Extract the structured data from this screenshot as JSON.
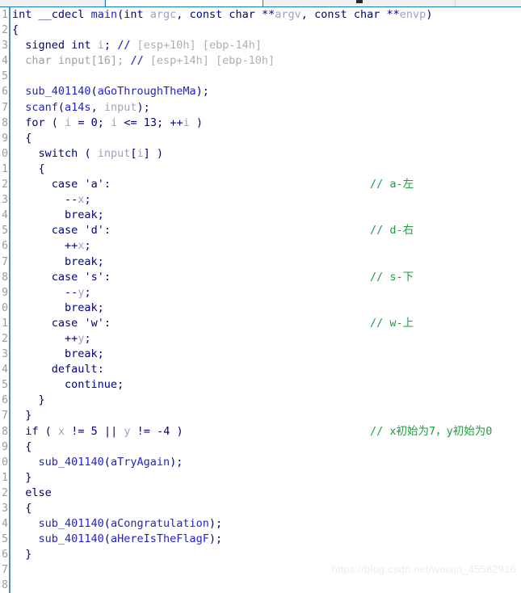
{
  "window": {
    "app": "IDA Pro - Hex-Rays Decompiler (Pseudocode view)",
    "tabs": [
      {
        "label": "",
        "active": false
      },
      {
        "label": "",
        "active": true
      },
      {
        "label": "",
        "active": false
      },
      {
        "label": "",
        "active": false
      }
    ]
  },
  "gutter": {
    "line_numbers": [
      "1",
      "2",
      "3",
      "4",
      "5",
      "6",
      "7",
      "8",
      "9",
      "0",
      "1",
      "2",
      "3",
      "4",
      "5",
      "6",
      "7",
      "8",
      "9",
      "0",
      "1",
      "2",
      "3",
      "4",
      "5",
      "6",
      "7",
      "8",
      "9",
      "0",
      "1",
      "2",
      "3",
      "4",
      "5",
      "6",
      "7",
      "8"
    ]
  },
  "code": {
    "language": "c",
    "lines": [
      {
        "n": 1,
        "text": "int __cdecl main(int argc, const char **argv, const char **envp)"
      },
      {
        "n": 2,
        "text": "{"
      },
      {
        "n": 3,
        "text": "  signed int i; // [esp+10h] [ebp-14h]"
      },
      {
        "n": 4,
        "text": "  char input[16]; // [esp+14h] [ebp-10h]"
      },
      {
        "n": 5,
        "text": ""
      },
      {
        "n": 6,
        "text": "  sub_401140(aGoThroughTheMa);"
      },
      {
        "n": 7,
        "text": "  scanf(a14s, input);"
      },
      {
        "n": 8,
        "text": "  for ( i = 0; i <= 13; ++i )"
      },
      {
        "n": 9,
        "text": "  {"
      },
      {
        "n": 10,
        "text": "    switch ( input[i] )"
      },
      {
        "n": 11,
        "text": "    {"
      },
      {
        "n": 12,
        "text": "      case 'a':",
        "comment": "// a-左"
      },
      {
        "n": 13,
        "text": "        --x;"
      },
      {
        "n": 14,
        "text": "        break;"
      },
      {
        "n": 15,
        "text": "      case 'd':",
        "comment": "// d-右"
      },
      {
        "n": 16,
        "text": "        ++x;"
      },
      {
        "n": 17,
        "text": "        break;"
      },
      {
        "n": 18,
        "text": "      case 's':",
        "comment": "// s-下"
      },
      {
        "n": 19,
        "text": "        --y;"
      },
      {
        "n": 20,
        "text": "        break;"
      },
      {
        "n": 21,
        "text": "      case 'w':",
        "comment": "// w-上"
      },
      {
        "n": 22,
        "text": "        ++y;"
      },
      {
        "n": 23,
        "text": "        break;"
      },
      {
        "n": 24,
        "text": "      default:"
      },
      {
        "n": 25,
        "text": "        continue;"
      },
      {
        "n": 26,
        "text": "    }"
      },
      {
        "n": 27,
        "text": "  }"
      },
      {
        "n": 28,
        "text": "  if ( x != 5 || y != -4 )",
        "comment": "// x初始为7，y初始为0"
      },
      {
        "n": 29,
        "text": "  {"
      },
      {
        "n": 30,
        "text": "    sub_401140(aTryAgain);"
      },
      {
        "n": 31,
        "text": "  }"
      },
      {
        "n": 32,
        "text": "  else"
      },
      {
        "n": 33,
        "text": "  {"
      },
      {
        "n": 34,
        "text": "    sub_401140(aCongratulation);"
      },
      {
        "n": 35,
        "text": "    sub_401140(aHereIsTheFlagF);"
      },
      {
        "n": 36,
        "text": "  }"
      }
    ],
    "comments": {
      "case_a": "// a-左",
      "case_d": "// d-右",
      "case_s": "// s-下",
      "case_w": "// w-上",
      "if_check": "// x初始为7，y初始为0",
      "decl_i": "[esp+10h] [ebp-14h]",
      "decl_input": "[esp+14h] [ebp-10h]"
    },
    "identifiers": {
      "function": "main",
      "calling_convention": "__cdecl",
      "sub_address": "sub_401140",
      "strings": [
        "aGoThroughTheMa",
        "a14s",
        "aTryAgain",
        "aCongratulation",
        "aHereIsTheFlagF"
      ],
      "locals": [
        "i",
        "input",
        "x",
        "y"
      ],
      "params": [
        "argc",
        "argv",
        "envp"
      ],
      "loop_bound": "13",
      "buffer_size": "16",
      "check_x": "5",
      "check_y": "-4"
    }
  },
  "watermark": {
    "text": "https://blog.csdn.net/weixin_45582916"
  },
  "colors": {
    "keyword": "#000080",
    "function": "#2222cc",
    "string": "#2222cc",
    "local_var": "#a0a0c0",
    "comment": "#1f9b3f",
    "stack_comment": "#b0b0b0",
    "gutter_text": "#9a9a9a",
    "gutter_border": "#4a8fc0",
    "background": "#ffffff",
    "tab_underline": "#1a7ec8"
  }
}
